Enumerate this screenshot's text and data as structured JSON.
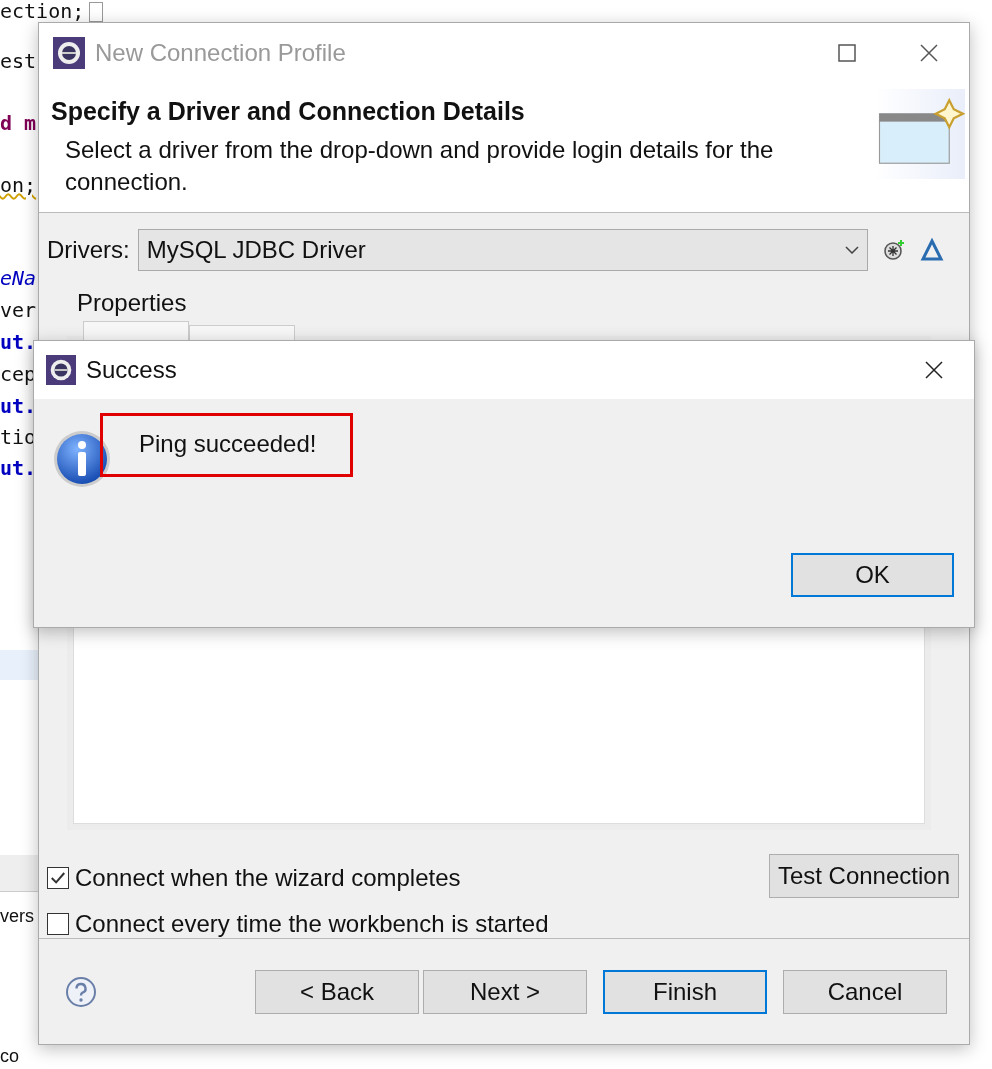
{
  "editor": {
    "lines": [
      {
        "text": "ection;",
        "kind": "plain"
      },
      {
        "text": "est",
        "kind": "plain"
      },
      {
        "text": "d m",
        "kind": "keyword"
      },
      {
        "text": "on;",
        "kind": "warning"
      },
      {
        "text": "eNa",
        "kind": "italic"
      },
      {
        "text": "ver",
        "kind": "plain"
      },
      {
        "text": "ut.",
        "kind": "field"
      },
      {
        "text": "cep",
        "kind": "plain"
      },
      {
        "text": "ut.",
        "kind": "field"
      },
      {
        "text": "tio",
        "kind": "plain"
      },
      {
        "text": "ut.",
        "kind": "field"
      }
    ],
    "bottom_tab": "vers",
    "bottom_text": "co"
  },
  "main": {
    "title": "New Connection Profile",
    "heading": "Specify a Driver and Connection Details",
    "description": "Select a driver from the drop-down and provide login details for the connection.",
    "drivers_label": "Drivers:",
    "driver": "MySQL JDBC Driver",
    "properties_label": "Properties",
    "checkboxes": [
      {
        "label": "Connect when the wizard completes",
        "checked": true
      },
      {
        "label": "Connect every time the workbench is started",
        "checked": false
      }
    ],
    "test_button": "Test Connection",
    "buttons": [
      {
        "label": "< Back",
        "default": false
      },
      {
        "label": "Next >",
        "default": false
      },
      {
        "label": "Finish",
        "default": true
      },
      {
        "label": "Cancel",
        "default": false
      }
    ]
  },
  "message": {
    "title": "Success",
    "text": "Ping succeeded!",
    "highlighted": true,
    "ok": "OK"
  }
}
